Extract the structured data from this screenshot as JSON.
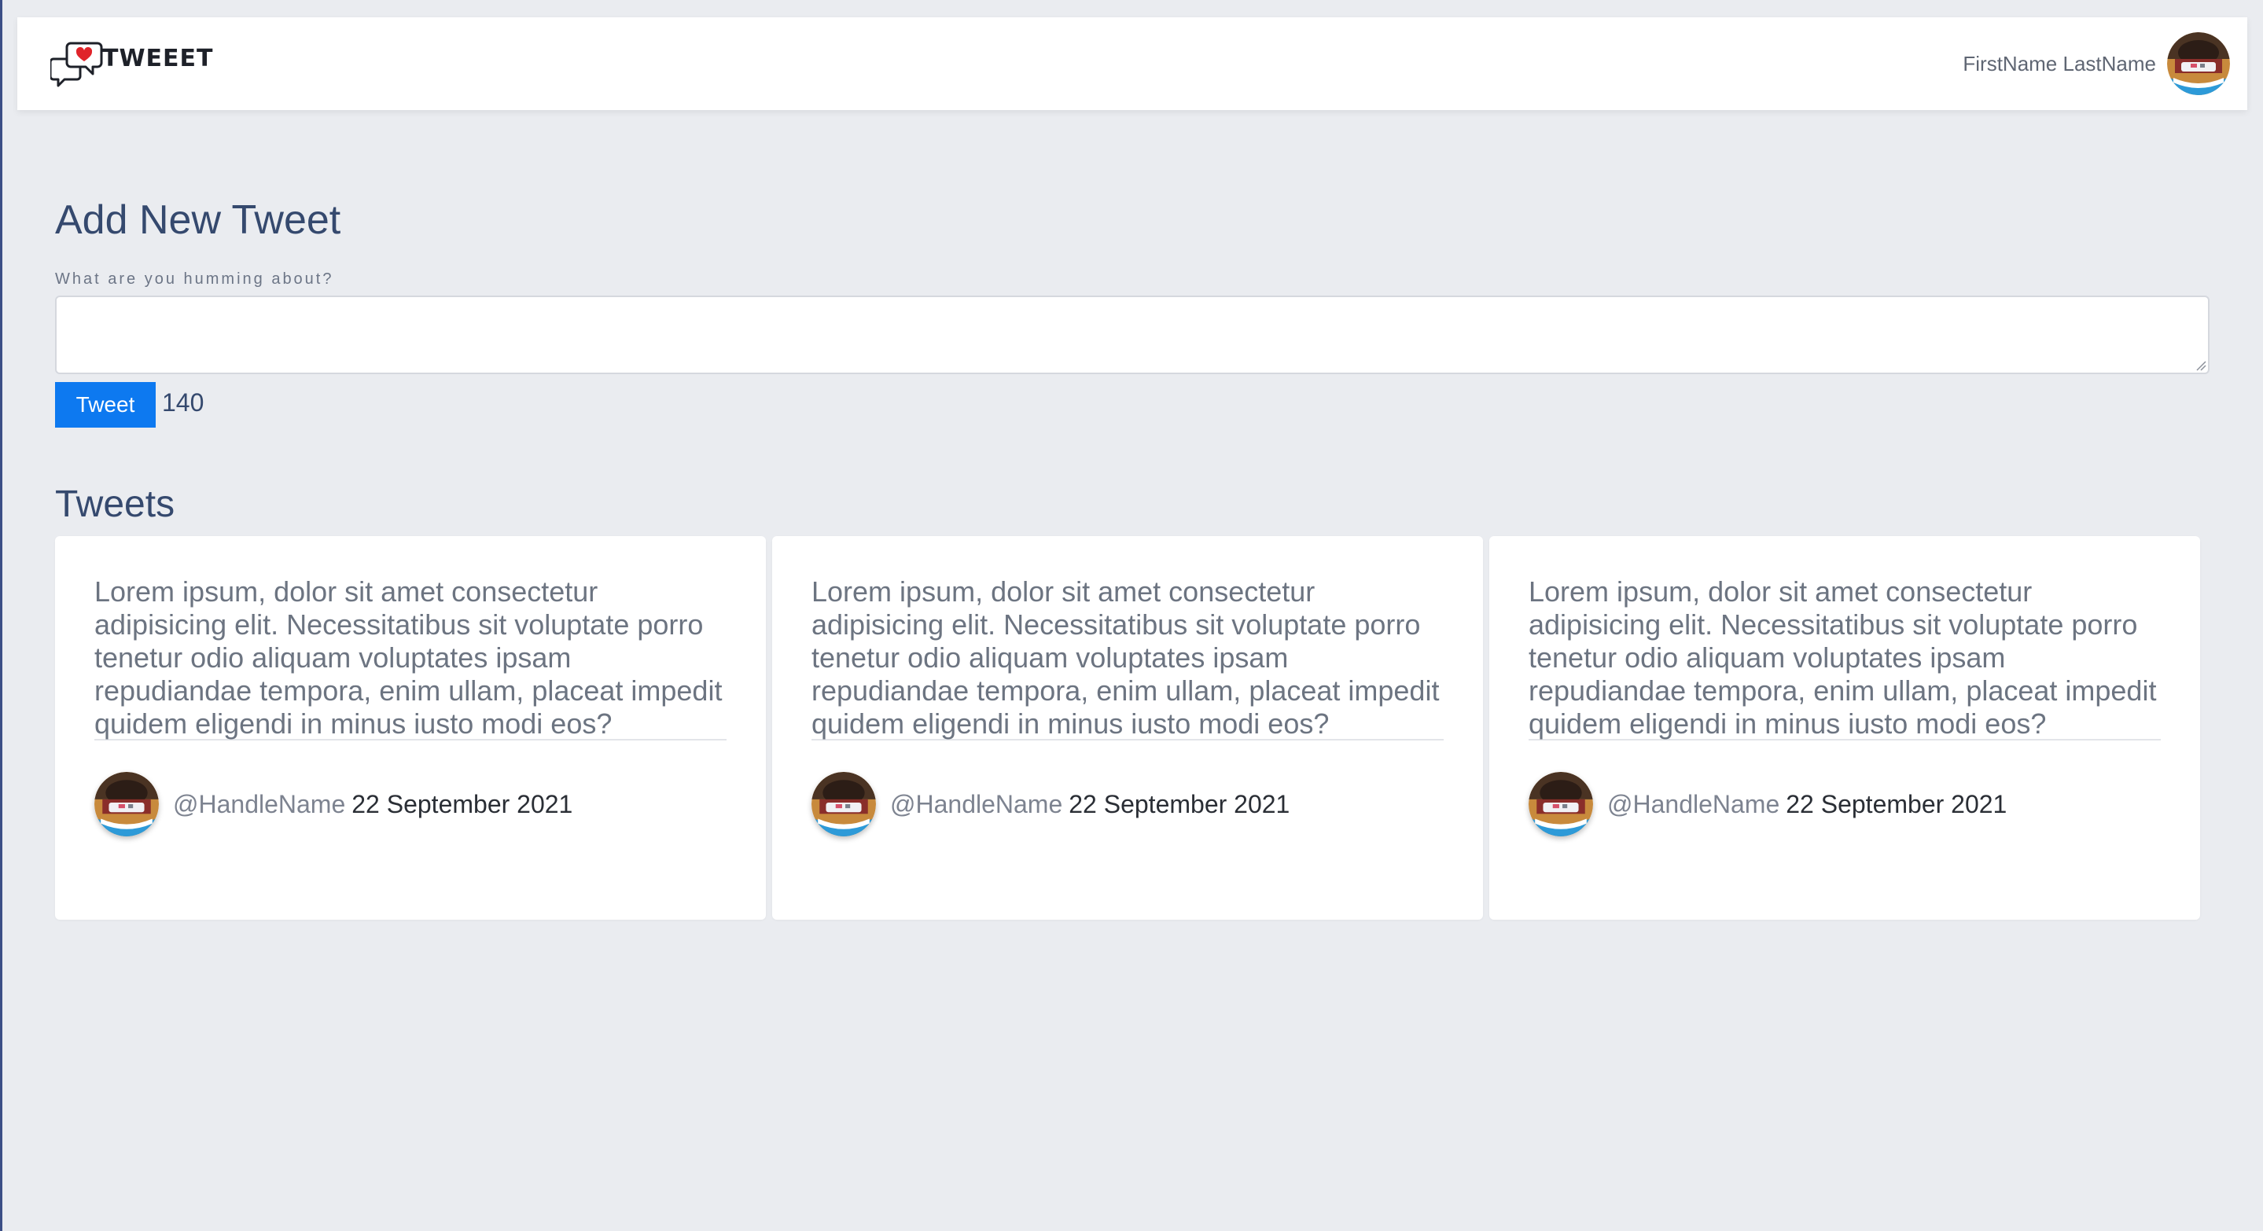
{
  "navbar": {
    "brand_name": "TWEEET",
    "logo_icon": "chat-bubbles-heart-icon",
    "user_name": "FirstName LastName",
    "avatar_icon": "avatar"
  },
  "composer": {
    "title": "Add New Tweet",
    "label": "What are you humming about?",
    "value": "",
    "submit_label": "Tweet",
    "char_count": "140"
  },
  "feed": {
    "title": "Tweets",
    "tweets": [
      {
        "body": "Lorem ipsum, dolor sit amet consectetur adipisicing elit. Necessitatibus sit voluptate porro tenetur odio aliquam voluptates ipsam repudiandae tempora, enim ullam, placeat impedit quidem eligendi in minus iusto modi eos?",
        "handle": "@HandleName",
        "date": "22 September 2021"
      },
      {
        "body": "Lorem ipsum, dolor sit amet consectetur adipisicing elit. Necessitatibus sit voluptate porro tenetur odio aliquam voluptates ipsam repudiandae tempora, enim ullam, placeat impedit quidem eligendi in minus iusto modi eos?",
        "handle": "@HandleName",
        "date": "22 September 2021"
      },
      {
        "body": "Lorem ipsum, dolor sit amet consectetur adipisicing elit. Necessitatibus sit voluptate porro tenetur odio aliquam voluptates ipsam repudiandae tempora, enim ullam, placeat impedit quidem eligendi in minus iusto modi eos?",
        "handle": "@HandleName",
        "date": "22 September 2021"
      }
    ]
  },
  "colors": {
    "background": "#eaecf0",
    "accent": "#0d79f0",
    "heading": "#35496e",
    "heart": "#e0242a"
  }
}
